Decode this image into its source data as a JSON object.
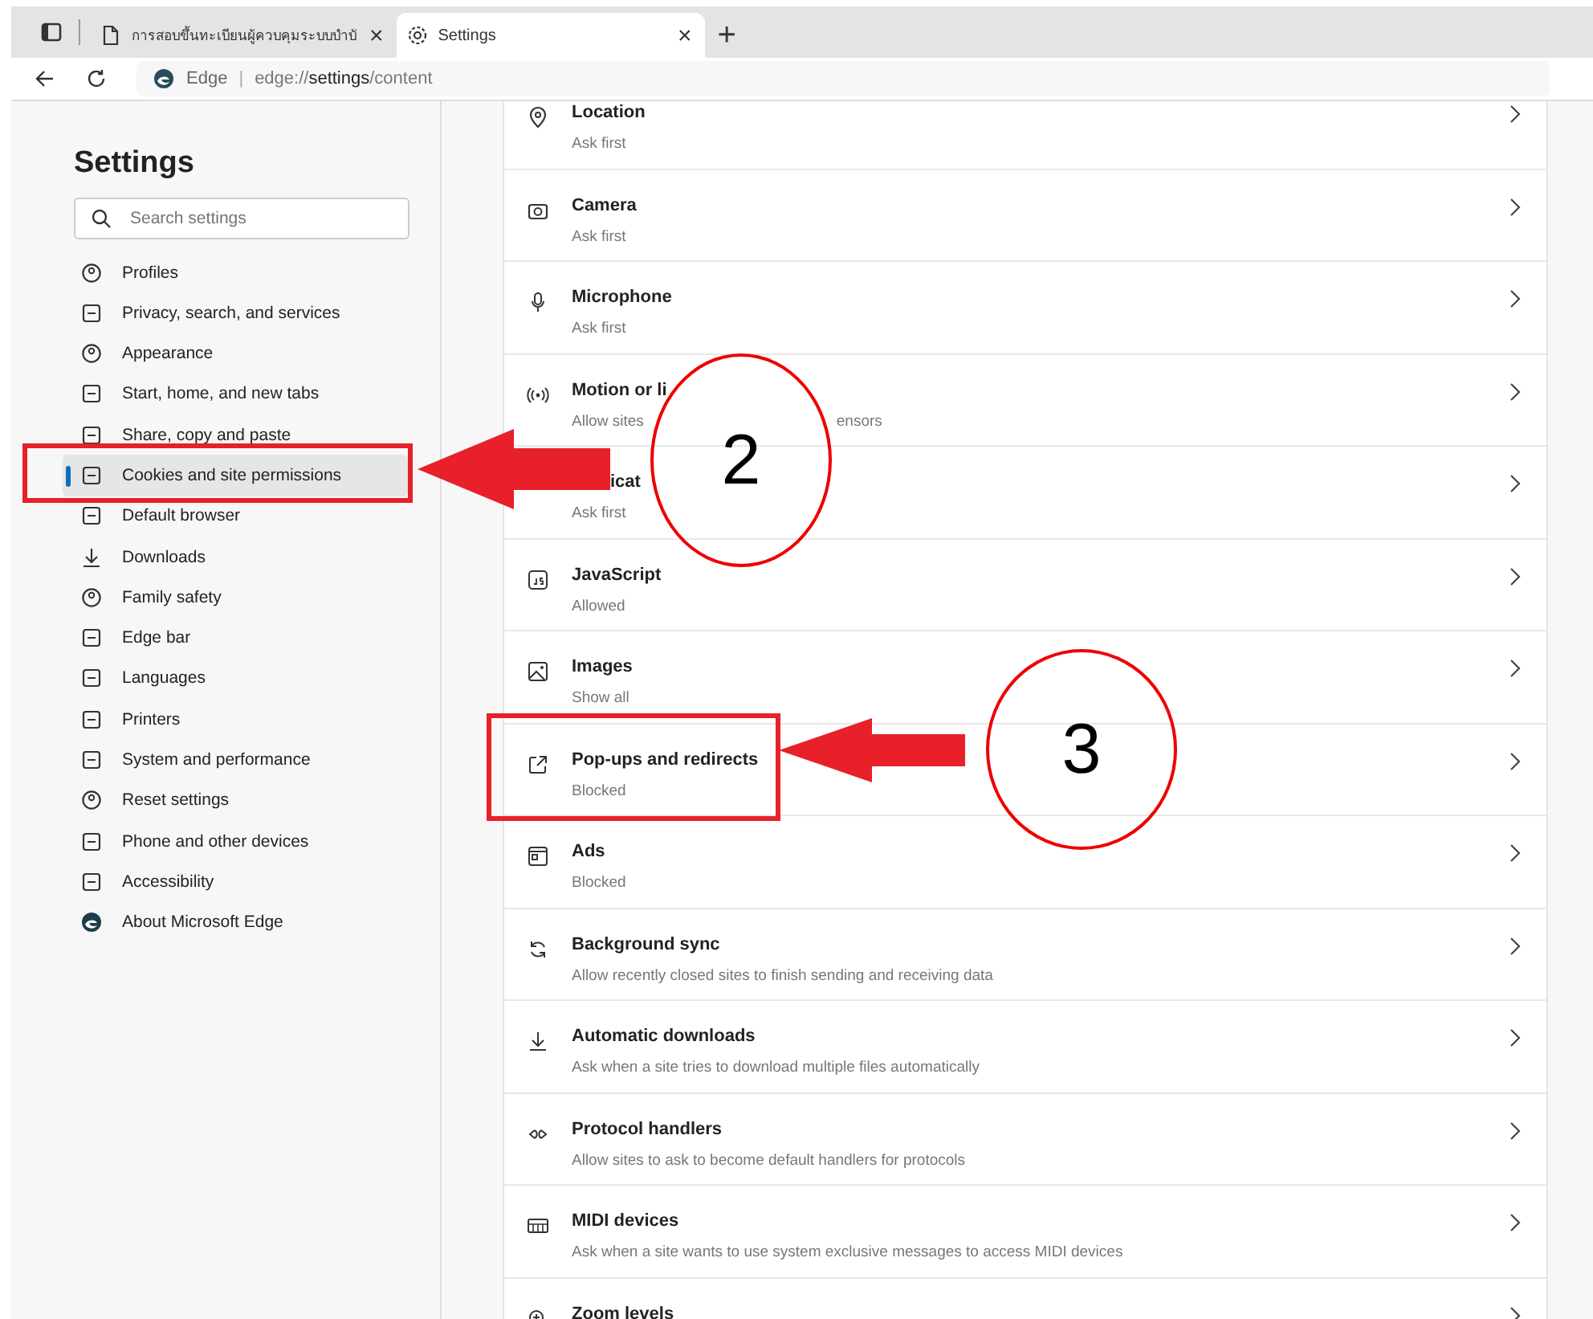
{
  "tabs": [
    {
      "title": "การสอบขึ้นทะเบียนผู้ควบคุมระบบบำบั",
      "close": "×",
      "selected": false
    },
    {
      "title": "Settings",
      "close": "×",
      "selected": true
    }
  ],
  "new_tab": "+",
  "address_bar": {
    "site_label": "Edge",
    "separator": "|",
    "url": "edge://**settings**/content"
  },
  "sidebar": {
    "title": "Settings",
    "search": {
      "placeholder": "Search settings"
    },
    "items": [
      {
        "label": "Profiles",
        "selected": false
      },
      {
        "label": "Privacy, search, and services",
        "selected": false
      },
      {
        "label": "Appearance",
        "selected": false
      },
      {
        "label": "Start, home, and new tabs",
        "selected": false
      },
      {
        "label": "Share, copy and paste",
        "selected": false
      },
      {
        "label": "Cookies and site permissions",
        "selected": true
      },
      {
        "label": "Default browser",
        "selected": false
      },
      {
        "label": "Downloads",
        "selected": false
      },
      {
        "label": "Family safety",
        "selected": false
      },
      {
        "label": "Edge bar",
        "selected": false
      },
      {
        "label": "Languages",
        "selected": false
      },
      {
        "label": "Printers",
        "selected": false
      },
      {
        "label": "System and performance",
        "selected": false
      },
      {
        "label": "Reset settings",
        "selected": false
      },
      {
        "label": "Phone and other devices",
        "selected": false
      },
      {
        "label": "Accessibility",
        "selected": false
      },
      {
        "label": "About Microsoft Edge",
        "selected": false
      }
    ]
  },
  "permissions": [
    {
      "kind": "plain",
      "title": "Location",
      "description": "Ask first"
    },
    {
      "kind": "plain",
      "title": "Camera",
      "description": "Ask first"
    },
    {
      "kind": "plain",
      "title": "Microphone",
      "description": "Ask first"
    },
    {
      "kind": "description_split",
      "title": "Motion or li",
      "description": "Allow sites",
      "description_tail": "ensors"
    },
    {
      "kind": "title_covered",
      "title": "icat",
      "description": "Ask first"
    },
    {
      "kind": "plain",
      "title": "JavaScript",
      "description": "Allowed"
    },
    {
      "kind": "plain",
      "title": "Images",
      "description": "Show all"
    },
    {
      "kind": "plain",
      "title": "Pop-ups and redirects",
      "description": "Blocked"
    },
    {
      "kind": "plain",
      "title": "Ads",
      "description": "Blocked"
    },
    {
      "kind": "plain",
      "title": "Background sync",
      "description": "Allow recently closed sites to finish sending and receiving data"
    },
    {
      "kind": "plain",
      "title": "Automatic downloads",
      "description": "Ask when a site tries to download multiple files automatically"
    },
    {
      "kind": "plain",
      "title": "Protocol handlers",
      "description": "Allow sites to ask to become default handlers for protocols"
    },
    {
      "kind": "plain",
      "title": "MIDI devices",
      "description": "Ask when a site wants to use system exclusive messages to access MIDI devices"
    },
    {
      "kind": "plain",
      "title": "Zoom levels"
    }
  ],
  "callouts": [
    {
      "number": "2"
    },
    {
      "number": "3"
    }
  ]
}
